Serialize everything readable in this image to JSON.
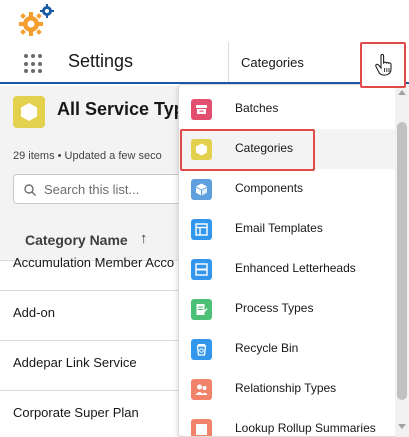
{
  "nav": {
    "app_title": "Settings",
    "current_tab": "Categories"
  },
  "list": {
    "title": "All Service Typ",
    "meta": "29 items • Updated a few seco",
    "search_placeholder": "Search this list...",
    "column_header": "Category Name",
    "sort_indicator": "↑",
    "rows": [
      "Accumulation Member Acco",
      "Add-on",
      "Addepar Link Service",
      "Corporate Super Plan"
    ]
  },
  "dropdown": {
    "items": [
      {
        "label": "Batches",
        "icon": "batches-icon",
        "color": "#e3506f"
      },
      {
        "label": "Categories",
        "icon": "hexagon-icon",
        "color": "#e3d04d"
      },
      {
        "label": "Components",
        "icon": "cube-icon",
        "color": "#5ea0dd"
      },
      {
        "label": "Email Templates",
        "icon": "email-template-icon",
        "color": "#3296ed"
      },
      {
        "label": "Enhanced Letterheads",
        "icon": "letterhead-icon",
        "color": "#3296ed"
      },
      {
        "label": "Process Types",
        "icon": "process-icon",
        "color": "#4bc076"
      },
      {
        "label": "Recycle Bin",
        "icon": "recycle-bin-icon",
        "color": "#3296ed"
      },
      {
        "label": "Relationship Types",
        "icon": "relationship-icon",
        "color": "#f2836b"
      },
      {
        "label": "Lookup Rollup Summaries",
        "icon": "rollup-icon",
        "color": "#f2836b"
      }
    ]
  },
  "colors": {
    "accent": "#1b5aa5",
    "highlight_outline": "#e24a4a",
    "logo_orange": "#f39e2f",
    "logo_blue": "#1b5aa5"
  }
}
